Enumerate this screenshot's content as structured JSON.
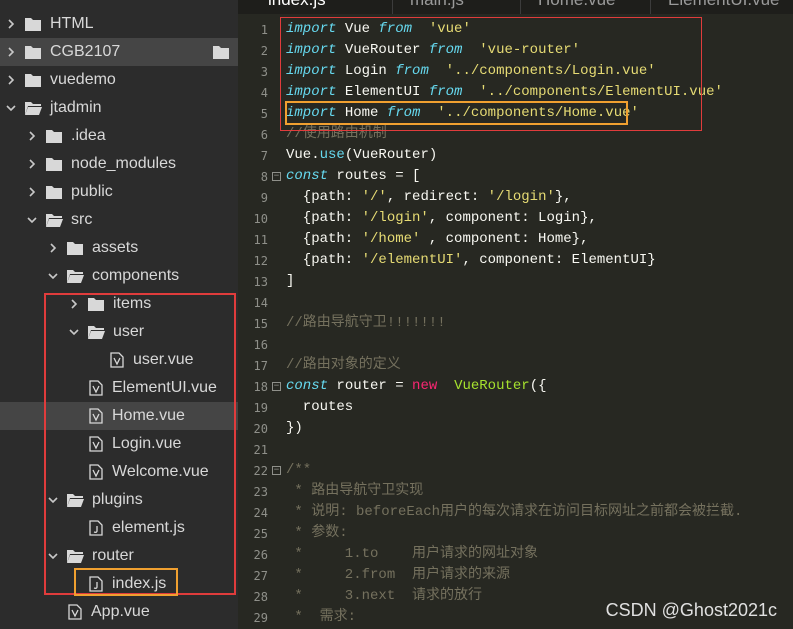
{
  "tabs": [
    "index.js",
    "main.js",
    "Home.vue",
    "ElementUI.vue"
  ],
  "tree": [
    {
      "label": "HTML",
      "type": "folder",
      "expanded": false,
      "depth": 0
    },
    {
      "label": "CGB2107",
      "type": "folder",
      "expanded": false,
      "depth": 0,
      "selected": true
    },
    {
      "label": "vuedemo",
      "type": "folder",
      "expanded": false,
      "depth": 0
    },
    {
      "label": "jtadmin",
      "type": "folder",
      "expanded": true,
      "depth": 0
    },
    {
      "label": ".idea",
      "type": "folder",
      "expanded": false,
      "depth": 1
    },
    {
      "label": "node_modules",
      "type": "folder",
      "expanded": false,
      "depth": 1
    },
    {
      "label": "public",
      "type": "folder",
      "expanded": false,
      "depth": 1
    },
    {
      "label": "src",
      "type": "folder",
      "expanded": true,
      "depth": 1
    },
    {
      "label": "assets",
      "type": "folder",
      "expanded": false,
      "depth": 2
    },
    {
      "label": "components",
      "type": "folder",
      "expanded": true,
      "depth": 2
    },
    {
      "label": "items",
      "type": "folder",
      "expanded": false,
      "depth": 3
    },
    {
      "label": "user",
      "type": "folder",
      "expanded": true,
      "depth": 3
    },
    {
      "label": "user.vue",
      "type": "vue",
      "depth": 4
    },
    {
      "label": "ElementUI.vue",
      "type": "vue",
      "depth": 3
    },
    {
      "label": "Home.vue",
      "type": "vue",
      "depth": 3,
      "selected": true
    },
    {
      "label": "Login.vue",
      "type": "vue",
      "depth": 3
    },
    {
      "label": "Welcome.vue",
      "type": "vue",
      "depth": 3
    },
    {
      "label": "plugins",
      "type": "folder",
      "expanded": true,
      "depth": 2
    },
    {
      "label": "element.js",
      "type": "js",
      "depth": 3
    },
    {
      "label": "router",
      "type": "folder",
      "expanded": true,
      "depth": 2
    },
    {
      "label": "index.js",
      "type": "js",
      "depth": 3
    },
    {
      "label": "App.vue",
      "type": "vue",
      "depth": 2
    }
  ],
  "code": [
    {
      "n": "1",
      "t": [
        [
          "kw",
          "import"
        ],
        [
          "",
          "Vue "
        ],
        [
          "kw",
          "from"
        ],
        [
          "str",
          " 'vue'"
        ]
      ]
    },
    {
      "n": "2",
      "t": [
        [
          "kw",
          "import"
        ],
        [
          "",
          "VueRouter "
        ],
        [
          "kw",
          "from"
        ],
        [
          "str",
          " 'vue-router'"
        ]
      ]
    },
    {
      "n": "3",
      "t": [
        [
          "kw",
          "import"
        ],
        [
          "",
          "Login "
        ],
        [
          "kw",
          "from"
        ],
        [
          "str",
          " '../components/Login.vue'"
        ]
      ]
    },
    {
      "n": "4",
      "t": [
        [
          "kw",
          "import"
        ],
        [
          "",
          "ElementUI "
        ],
        [
          "kw",
          "from"
        ],
        [
          "str",
          " '../components/ElementUI.vue'"
        ]
      ]
    },
    {
      "n": "5",
      "t": [
        [
          "kw",
          "import"
        ],
        [
          "",
          "Home "
        ],
        [
          "kw",
          "from"
        ],
        [
          "str",
          " '../components/Home.vue'"
        ]
      ]
    },
    {
      "n": "6",
      "t": [
        [
          "cmt",
          "//使用路由机制"
        ]
      ]
    },
    {
      "n": "7",
      "t": [
        [
          "",
          "Vue."
        ],
        [
          "fn",
          "use"
        ],
        [
          "",
          "(VueRouter)"
        ]
      ]
    },
    {
      "n": "8",
      "fold": true,
      "t": [
        [
          "kw",
          "const"
        ],
        [
          "",
          ""
        ],
        [
          "",
          "routes = ["
        ]
      ]
    },
    {
      "n": "9",
      "t": [
        [
          "",
          "  {path: "
        ],
        [
          "str",
          "'/'"
        ],
        [
          "",
          ", redirect: "
        ],
        [
          "str",
          "'/login'"
        ],
        [
          "",
          "},"
        ]
      ]
    },
    {
      "n": "10",
      "t": [
        [
          "",
          "  {path: "
        ],
        [
          "str",
          "'/login'"
        ],
        [
          "",
          ", component: Login},"
        ]
      ]
    },
    {
      "n": "11",
      "t": [
        [
          "",
          "  {path: "
        ],
        [
          "str",
          "'/home'"
        ],
        [
          "",
          " , component: Home},"
        ]
      ]
    },
    {
      "n": "12",
      "t": [
        [
          "",
          "  {path: "
        ],
        [
          "str",
          "'/elementUI'"
        ],
        [
          "",
          ", component: ElementUI}"
        ]
      ]
    },
    {
      "n": "13",
      "t": [
        [
          "",
          "]"
        ]
      ]
    },
    {
      "n": "14",
      "t": []
    },
    {
      "n": "15",
      "t": [
        [
          "cmt",
          "//路由导航守卫!!!!!!!"
        ]
      ]
    },
    {
      "n": "16",
      "t": []
    },
    {
      "n": "17",
      "t": [
        [
          "cmt",
          "//路由对象的定义"
        ]
      ]
    },
    {
      "n": "18",
      "fold": true,
      "t": [
        [
          "kw",
          "const"
        ],
        [
          "",
          ""
        ],
        [
          "",
          "router = "
        ],
        [
          "new",
          "new"
        ],
        [
          "",
          ""
        ],
        [
          "cls",
          " VueRouter"
        ],
        [
          "",
          "({"
        ]
      ]
    },
    {
      "n": "19",
      "t": [
        [
          "",
          "  routes"
        ]
      ]
    },
    {
      "n": "20",
      "t": [
        [
          "",
          "})"
        ]
      ]
    },
    {
      "n": "21",
      "t": []
    },
    {
      "n": "22",
      "fold": true,
      "t": [
        [
          "cmt",
          "/**"
        ]
      ]
    },
    {
      "n": "23",
      "t": [
        [
          "cmt",
          " * 路由导航守卫实现"
        ]
      ]
    },
    {
      "n": "24",
      "t": [
        [
          "cmt",
          " * 说明: beforeEach用户的每次请求在访问目标网址之前都会被拦截."
        ]
      ]
    },
    {
      "n": "25",
      "t": [
        [
          "cmt",
          " * 参数:"
        ]
      ]
    },
    {
      "n": "26",
      "t": [
        [
          "cmt",
          " *     1.to    用户请求的网址对象"
        ]
      ]
    },
    {
      "n": "27",
      "t": [
        [
          "cmt",
          " *     2.from  用户请求的来源"
        ]
      ]
    },
    {
      "n": "28",
      "t": [
        [
          "cmt",
          " *     3.next  请求的放行"
        ]
      ]
    },
    {
      "n": "29",
      "t": [
        [
          "cmt",
          " *  需求:"
        ]
      ]
    }
  ],
  "watermark": "CSDN @Ghost2021c"
}
